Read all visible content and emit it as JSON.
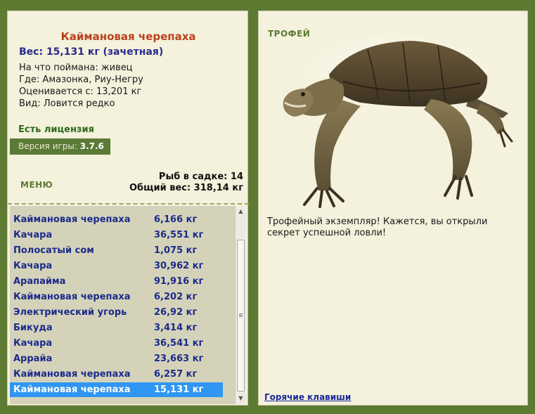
{
  "catch": {
    "title": "Каймановая черепаха",
    "weight": "Вес: 15,131 кг (зачетная)",
    "bait": "На что поймана: живец",
    "location": "Где: Амазонка, Риу-Негру",
    "valued_from": "Оценивается с: 13,201 кг",
    "rarity": "Вид: Ловится редко"
  },
  "license": "Есть лицензия",
  "version": {
    "label": "Версия игры: ",
    "value": "3.7.6"
  },
  "menu_label": "МЕНЮ",
  "stats": {
    "fish_in_keepnet": "Рыб в садке: 14",
    "total_weight": "Общий вес: 318,14 кг"
  },
  "fish_list": [
    {
      "name": "Каймановая черепаха",
      "weight": "6,166 кг"
    },
    {
      "name": "Качара",
      "weight": "36,551 кг"
    },
    {
      "name": "Полосатый сом",
      "weight": "1,075 кг"
    },
    {
      "name": "Качара",
      "weight": "30,962 кг"
    },
    {
      "name": "Арапайма",
      "weight": "91,916 кг"
    },
    {
      "name": "Каймановая черепаха",
      "weight": "6,202 кг"
    },
    {
      "name": "Электрический угорь",
      "weight": "26,92 кг"
    },
    {
      "name": "Бикуда",
      "weight": "3,414 кг"
    },
    {
      "name": "Качара",
      "weight": "36,541 кг"
    },
    {
      "name": "Аррайа",
      "weight": "23,663 кг"
    },
    {
      "name": "Каймановая черепаха",
      "weight": "6,257 кг"
    },
    {
      "name": "Каймановая черепаха",
      "weight": "15,131 кг"
    }
  ],
  "selected_index": 11,
  "trophy_label": "ТРОФЕЙ",
  "trophy_message": "Трофейный экземпляр! Кажется, вы открыли секрет успешной ловли!",
  "hotkeys_link": "Горячие клавиши",
  "colors": {
    "frame": "#5d7a32",
    "panel": "#f4f1dc",
    "title": "#b8421c",
    "list_text": "#1c2a8a",
    "selection": "#2f96f4"
  },
  "icons": [
    "turtle-image",
    "scroll-up-arrow-icon",
    "scroll-down-arrow-icon"
  ]
}
